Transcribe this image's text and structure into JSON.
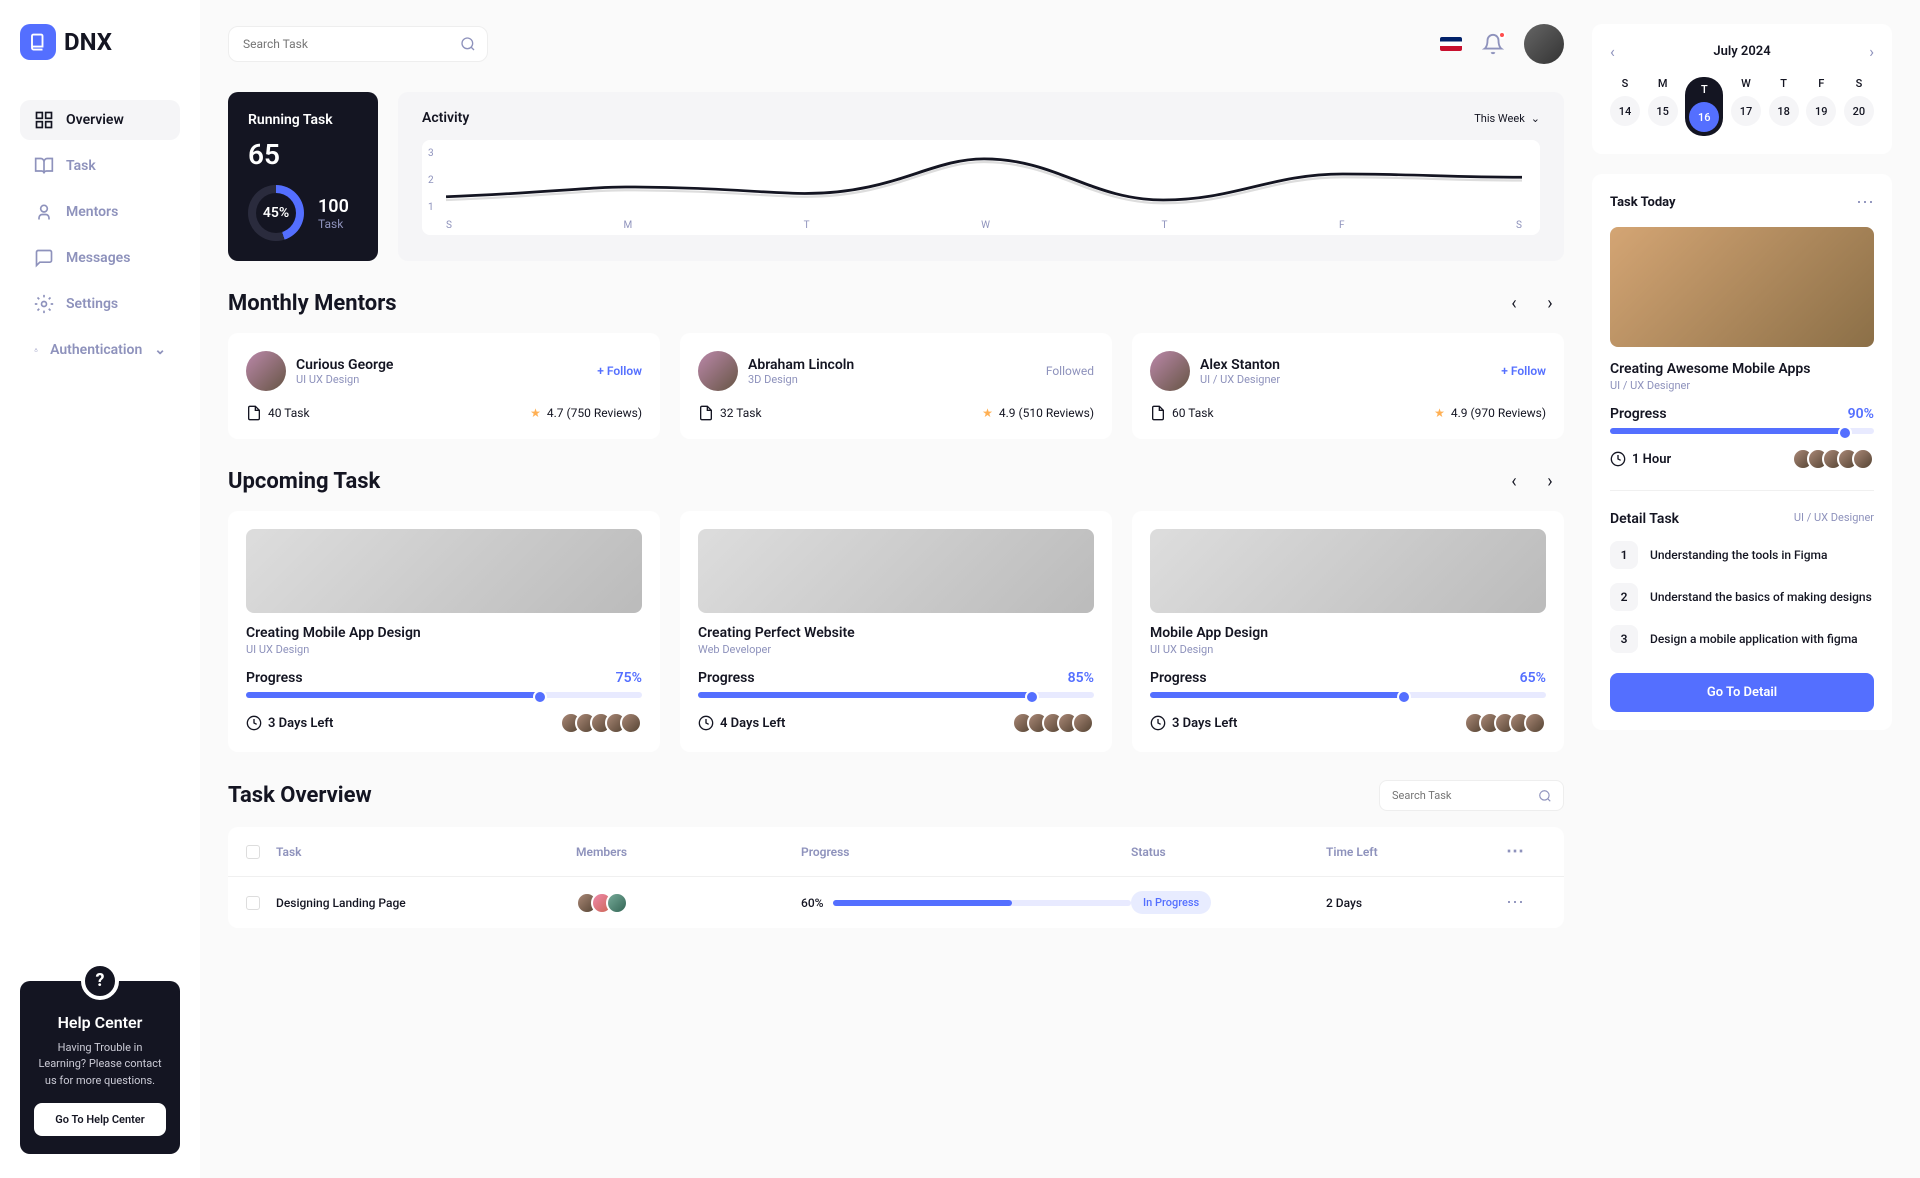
{
  "brand": "DNX",
  "search": {
    "placeholder": "Search Task"
  },
  "nav": {
    "overview": "Overview",
    "task": "Task",
    "mentors": "Mentors",
    "messages": "Messages",
    "settings": "Settings",
    "auth": "Authentication"
  },
  "help": {
    "title": "Help Center",
    "text": "Having Trouble in Learning? Please contact us for more questions.",
    "btn": "Go To Help Center"
  },
  "running": {
    "title": "Running Task",
    "count": "65",
    "pct": "45%",
    "total": "100",
    "label": "Task"
  },
  "activity": {
    "title": "Activity",
    "range": "This Week"
  },
  "chart_data": {
    "type": "line",
    "categories": [
      "S",
      "M",
      "T",
      "W",
      "T",
      "F",
      "S"
    ],
    "y_ticks": [
      1,
      2,
      3
    ],
    "ylim": [
      1,
      3
    ],
    "series": [
      {
        "name": "Activity",
        "values": [
          1.5,
          1.8,
          1.6,
          2.8,
          1.4,
          2.2,
          2.1
        ]
      }
    ]
  },
  "mentors_section": {
    "title": "Monthly Mentors"
  },
  "mentors": [
    {
      "name": "Curious George",
      "role": "UI UX Design",
      "follow": "+ Follow",
      "tasks": "40 Task",
      "rating": "4.7 (750 Reviews)"
    },
    {
      "name": "Abraham Lincoln",
      "role": "3D Design",
      "followed": "Followed",
      "tasks": "32 Task",
      "rating": "4.9 (510 Reviews)"
    },
    {
      "name": "Alex Stanton",
      "role": "UI / UX Designer",
      "follow": "+ Follow",
      "tasks": "60 Task",
      "rating": "4.9 (970 Reviews)"
    }
  ],
  "upcoming": {
    "title": "Upcoming Task"
  },
  "tasks": [
    {
      "title": "Creating Mobile App Design",
      "role": "UI UX Design",
      "prog_label": "Progress",
      "pct": "75%",
      "pct_w": "75%",
      "time": "3 Days Left"
    },
    {
      "title": "Creating Perfect Website",
      "role": "Web Developer",
      "prog_label": "Progress",
      "pct": "85%",
      "pct_w": "85%",
      "time": "4 Days Left"
    },
    {
      "title": "Mobile App Design",
      "role": "UI UX Design",
      "prog_label": "Progress",
      "pct": "65%",
      "pct_w": "65%",
      "time": "3 Days Left"
    }
  ],
  "overview": {
    "title": "Task Overview",
    "search_ph": "Search Task"
  },
  "table": {
    "headers": {
      "task": "Task",
      "members": "Members",
      "progress": "Progress",
      "status": "Status",
      "time": "Time Left"
    },
    "row": {
      "task": "Designing Landing Page",
      "pct": "60%",
      "pct_w": "60%",
      "status": "In Progress",
      "time": "2 Days"
    }
  },
  "calendar": {
    "month": "July 2024",
    "dows": [
      "S",
      "M",
      "T",
      "W",
      "T",
      "F",
      "S"
    ],
    "dates": [
      "14",
      "15",
      "16",
      "17",
      "18",
      "19",
      "20"
    ],
    "active": 2
  },
  "today": {
    "head": "Task Today",
    "title": "Creating Awesome Mobile Apps",
    "role": "UI / UX Designer",
    "prog_label": "Progress",
    "pct": "90%",
    "pct_w": "90%",
    "time": "1 Hour",
    "detail_head": "Detail Task",
    "detail_role": "UI / UX Designer",
    "steps": [
      "Understanding the tools in Figma",
      "Understand the basics of making designs",
      "Design a mobile application with figma"
    ],
    "btn": "Go To Detail"
  }
}
